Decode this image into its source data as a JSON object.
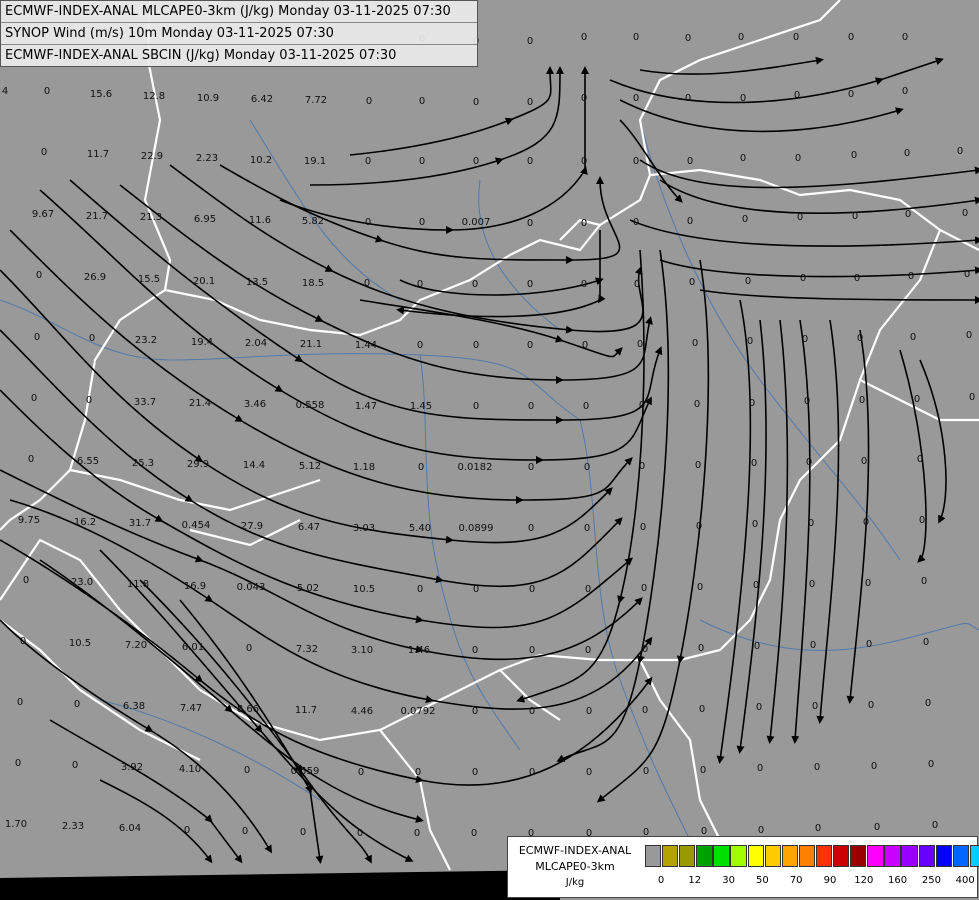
{
  "header": {
    "line1": "ECMWF-INDEX-ANAL MLCAPE0-3km (J/kg) Monday 03-11-2025 07:30",
    "line2": "SYNOP Wind (m/s) 10m Monday 03-11-2025 07:30",
    "line3": "ECMWF-INDEX-ANAL SBCIN (J/kg) Monday 03-11-2025 07:30"
  },
  "legend": {
    "title1": "ECMWF-INDEX-ANAL",
    "title2": "MLCAPE0-3km",
    "unit": "J/kg",
    "ticks": [
      "0",
      "12",
      "30",
      "50",
      "70",
      "90",
      "120",
      "160",
      "250",
      "400"
    ],
    "colors": [
      "#999999",
      "#b3a300",
      "#999900",
      "#00a000",
      "#00e000",
      "#a0ff00",
      "#ffff00",
      "#ffcc00",
      "#ffa500",
      "#ff7f00",
      "#ff3300",
      "#cc0000",
      "#990000",
      "#ff00ff",
      "#cc00ff",
      "#9900ff",
      "#6600ff",
      "#0000ff",
      "#0066ff",
      "#00ccff",
      "#00ffff",
      "#99ffff",
      "#ffffff"
    ]
  },
  "values": [
    [
      "4",
      5,
      90
    ],
    [
      "0",
      47,
      90
    ],
    [
      "15.6",
      101,
      93
    ],
    [
      "12.8",
      154,
      95
    ],
    [
      "10.9",
      208,
      97
    ],
    [
      "6.42",
      262,
      98
    ],
    [
      "7.72",
      316,
      99
    ],
    [
      "0",
      369,
      100
    ],
    [
      "0",
      422,
      100
    ],
    [
      "0",
      476,
      101
    ],
    [
      "0",
      530,
      101
    ],
    [
      "0",
      422,
      38
    ],
    [
      "0",
      476,
      40
    ],
    [
      "0",
      530,
      40
    ],
    [
      "0",
      584,
      36
    ],
    [
      "0",
      636,
      36
    ],
    [
      "0",
      688,
      37
    ],
    [
      "0",
      741,
      36
    ],
    [
      "0",
      796,
      36
    ],
    [
      "0",
      851,
      36
    ],
    [
      "0",
      905,
      36
    ],
    [
      "0",
      584,
      97
    ],
    [
      "0",
      636,
      97
    ],
    [
      "0",
      688,
      97
    ],
    [
      "0",
      743,
      97
    ],
    [
      "0",
      797,
      94
    ],
    [
      "0",
      851,
      93
    ],
    [
      "0",
      905,
      90
    ],
    [
      "0",
      44,
      151
    ],
    [
      "11.7",
      98,
      153
    ],
    [
      "22.9",
      152,
      155
    ],
    [
      "2.23",
      207,
      157
    ],
    [
      "10.2",
      261,
      159
    ],
    [
      "19.1",
      315,
      160
    ],
    [
      "0",
      368,
      160
    ],
    [
      "0",
      422,
      160
    ],
    [
      "0",
      476,
      160
    ],
    [
      "0",
      530,
      160
    ],
    [
      "0",
      584,
      160
    ],
    [
      "0",
      636,
      160
    ],
    [
      "0",
      690,
      160
    ],
    [
      "0",
      743,
      157
    ],
    [
      "0",
      798,
      157
    ],
    [
      "0",
      854,
      154
    ],
    [
      "0",
      907,
      152
    ],
    [
      "0",
      960,
      150
    ],
    [
      "9.67",
      43,
      213
    ],
    [
      "21.7",
      97,
      215
    ],
    [
      "21.3",
      151,
      216
    ],
    [
      "6.95",
      205,
      218
    ],
    [
      "11.6",
      260,
      219
    ],
    [
      "5.82",
      313,
      220
    ],
    [
      "0",
      368,
      221
    ],
    [
      "0",
      422,
      221
    ],
    [
      "0.007",
      476,
      221
    ],
    [
      "0",
      530,
      222
    ],
    [
      "0",
      584,
      222
    ],
    [
      "0",
      636,
      221
    ],
    [
      "0",
      690,
      220
    ],
    [
      "0",
      745,
      218
    ],
    [
      "0",
      800,
      216
    ],
    [
      "0",
      855,
      215
    ],
    [
      "0",
      908,
      213
    ],
    [
      "0",
      965,
      212
    ],
    [
      "0",
      39,
      274
    ],
    [
      "26.9",
      95,
      276
    ],
    [
      "15.5",
      149,
      278
    ],
    [
      "20.1",
      204,
      280
    ],
    [
      "13.5",
      257,
      281
    ],
    [
      "18.5",
      313,
      282
    ],
    [
      "0",
      367,
      282
    ],
    [
      "0",
      420,
      283
    ],
    [
      "0",
      475,
      283
    ],
    [
      "0",
      530,
      283
    ],
    [
      "0",
      584,
      283
    ],
    [
      "0",
      637,
      283
    ],
    [
      "0",
      692,
      281
    ],
    [
      "0",
      748,
      280
    ],
    [
      "0",
      803,
      277
    ],
    [
      "0",
      857,
      277
    ],
    [
      "0",
      911,
      275
    ],
    [
      "0",
      967,
      273
    ],
    [
      "0",
      37,
      336
    ],
    [
      "0",
      92,
      337
    ],
    [
      "23.2",
      146,
      339
    ],
    [
      "19.4",
      202,
      341
    ],
    [
      "2.04",
      256,
      342
    ],
    [
      "21.1",
      311,
      343
    ],
    [
      "1.44",
      366,
      344
    ],
    [
      "0",
      420,
      344
    ],
    [
      "0",
      476,
      344
    ],
    [
      "0",
      530,
      344
    ],
    [
      "0",
      585,
      344
    ],
    [
      "0",
      640,
      343
    ],
    [
      "0",
      695,
      342
    ],
    [
      "0",
      750,
      340
    ],
    [
      "0",
      805,
      338
    ],
    [
      "0",
      860,
      337
    ],
    [
      "0",
      913,
      336
    ],
    [
      "0",
      969,
      334
    ],
    [
      "0",
      34,
      397
    ],
    [
      "0",
      89,
      399
    ],
    [
      "33.7",
      145,
      401
    ],
    [
      "21.4",
      200,
      402
    ],
    [
      "3.46",
      255,
      403
    ],
    [
      "0.558",
      310,
      404
    ],
    [
      "1.47",
      366,
      405
    ],
    [
      "1.45",
      421,
      405
    ],
    [
      "0",
      476,
      405
    ],
    [
      "0",
      531,
      405
    ],
    [
      "0",
      586,
      405
    ],
    [
      "0",
      642,
      404
    ],
    [
      "0",
      697,
      403
    ],
    [
      "0",
      752,
      402
    ],
    [
      "0",
      807,
      400
    ],
    [
      "0",
      862,
      399
    ],
    [
      "0",
      917,
      398
    ],
    [
      "0",
      972,
      396
    ],
    [
      "0",
      31,
      458
    ],
    [
      "6.55",
      88,
      460
    ],
    [
      "25.3",
      143,
      462
    ],
    [
      "29.9",
      198,
      463
    ],
    [
      "14.4",
      254,
      464
    ],
    [
      "5.12",
      310,
      465
    ],
    [
      "1.18",
      364,
      466
    ],
    [
      "0",
      421,
      466
    ],
    [
      "0.0182",
      475,
      466
    ],
    [
      "0",
      531,
      466
    ],
    [
      "0",
      587,
      466
    ],
    [
      "0",
      642,
      465
    ],
    [
      "0",
      698,
      464
    ],
    [
      "0",
      754,
      462
    ],
    [
      "0",
      809,
      461
    ],
    [
      "0",
      864,
      460
    ],
    [
      "0",
      920,
      458
    ],
    [
      "9.75",
      29,
      519
    ],
    [
      "16.2",
      85,
      521
    ],
    [
      "31.7",
      140,
      522
    ],
    [
      "0.454",
      196,
      524
    ],
    [
      "27.9",
      252,
      525
    ],
    [
      "6.47",
      309,
      526
    ],
    [
      "3.03",
      364,
      527
    ],
    [
      "5.40",
      420,
      527
    ],
    [
      "0.0899",
      476,
      527
    ],
    [
      "0",
      531,
      527
    ],
    [
      "0",
      587,
      527
    ],
    [
      "0",
      643,
      526
    ],
    [
      "0",
      699,
      525
    ],
    [
      "0",
      755,
      523
    ],
    [
      "0",
      811,
      522
    ],
    [
      "0",
      866,
      521
    ],
    [
      "0",
      922,
      519
    ],
    [
      "0",
      26,
      579
    ],
    [
      "23.0",
      82,
      581
    ],
    [
      "11.8",
      138,
      583
    ],
    [
      "16.9",
      195,
      585
    ],
    [
      "0.043",
      251,
      586
    ],
    [
      "5.02",
      308,
      587
    ],
    [
      "10.5",
      364,
      588
    ],
    [
      "0",
      420,
      588
    ],
    [
      "0",
      476,
      588
    ],
    [
      "0",
      532,
      588
    ],
    [
      "0",
      588,
      588
    ],
    [
      "0",
      644,
      587
    ],
    [
      "0",
      700,
      586
    ],
    [
      "0",
      756,
      584
    ],
    [
      "0",
      812,
      583
    ],
    [
      "0",
      868,
      582
    ],
    [
      "0",
      924,
      580
    ],
    [
      "0",
      23,
      640
    ],
    [
      "10.5",
      80,
      642
    ],
    [
      "7.20",
      136,
      644
    ],
    [
      "6.01",
      193,
      646
    ],
    [
      "0",
      249,
      647
    ],
    [
      "7.32",
      307,
      648
    ],
    [
      "3.10",
      362,
      649
    ],
    [
      "1.46",
      419,
      649
    ],
    [
      "0",
      475,
      649
    ],
    [
      "0",
      532,
      649
    ],
    [
      "0",
      588,
      649
    ],
    [
      "0",
      645,
      648
    ],
    [
      "0",
      701,
      647
    ],
    [
      "0",
      757,
      645
    ],
    [
      "0",
      813,
      644
    ],
    [
      "0",
      869,
      643
    ],
    [
      "0",
      926,
      641
    ],
    [
      "0",
      20,
      701
    ],
    [
      "0",
      77,
      703
    ],
    [
      "6.38",
      134,
      705
    ],
    [
      "7.47",
      191,
      707
    ],
    [
      "8.66",
      248,
      708
    ],
    [
      "11.7",
      306,
      709
    ],
    [
      "4.46",
      362,
      710
    ],
    [
      "0.0792",
      418,
      710
    ],
    [
      "0",
      475,
      710
    ],
    [
      "0",
      532,
      710
    ],
    [
      "0",
      589,
      710
    ],
    [
      "0",
      645,
      709
    ],
    [
      "0",
      702,
      708
    ],
    [
      "0",
      759,
      706
    ],
    [
      "0",
      815,
      705
    ],
    [
      "0",
      871,
      704
    ],
    [
      "0",
      928,
      702
    ],
    [
      "0",
      18,
      762
    ],
    [
      "0",
      75,
      764
    ],
    [
      "3.92",
      132,
      766
    ],
    [
      "4.10",
      190,
      768
    ],
    [
      "0",
      247,
      769
    ],
    [
      "0.559",
      305,
      770
    ],
    [
      "0",
      361,
      771
    ],
    [
      "0",
      418,
      771
    ],
    [
      "0",
      475,
      771
    ],
    [
      "0",
      532,
      771
    ],
    [
      "0",
      589,
      771
    ],
    [
      "0",
      646,
      770
    ],
    [
      "0",
      703,
      769
    ],
    [
      "0",
      760,
      767
    ],
    [
      "0",
      817,
      766
    ],
    [
      "0",
      874,
      765
    ],
    [
      "0",
      931,
      763
    ],
    [
      "1.70",
      16,
      823
    ],
    [
      "2.33",
      73,
      825
    ],
    [
      "6.04",
      130,
      827
    ],
    [
      "0",
      187,
      829
    ],
    [
      "0",
      245,
      830
    ],
    [
      "0",
      303,
      831
    ],
    [
      "0",
      360,
      832
    ],
    [
      "0",
      417,
      832
    ],
    [
      "0",
      474,
      832
    ],
    [
      "0",
      531,
      832
    ],
    [
      "0",
      589,
      832
    ],
    [
      "0",
      646,
      831
    ],
    [
      "0",
      704,
      830
    ],
    [
      "0",
      761,
      829
    ],
    [
      "0",
      818,
      827
    ],
    [
      "0",
      877,
      826
    ],
    [
      "0",
      935,
      824
    ]
  ]
}
